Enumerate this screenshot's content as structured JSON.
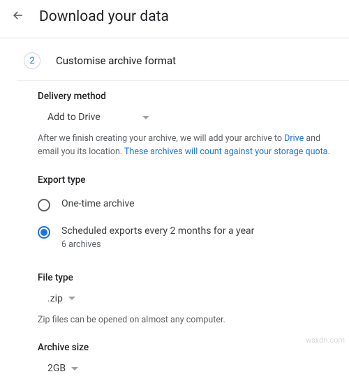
{
  "header": {
    "title": "Download your data"
  },
  "step": {
    "number": "2",
    "title": "Customise archive format"
  },
  "delivery": {
    "label": "Delivery method",
    "selected": "Add to Drive",
    "helper_prefix": "After we finish creating your archive, we will add your archive to ",
    "helper_link1": "Drive",
    "helper_mid": " and email you its location. ",
    "helper_link2": "These archives will count against your storage quota."
  },
  "export": {
    "label": "Export type",
    "options": [
      {
        "label": "One-time archive",
        "checked": false
      },
      {
        "label": "Scheduled exports every 2 months for a year",
        "checked": true,
        "sublabel": "6 archives"
      }
    ]
  },
  "filetype": {
    "label": "File type",
    "selected": ".zip",
    "helper": "Zip files can be opened on almost any computer."
  },
  "archivesize": {
    "label": "Archive size",
    "selected": "2GB"
  },
  "watermark": "wsxdn.com"
}
